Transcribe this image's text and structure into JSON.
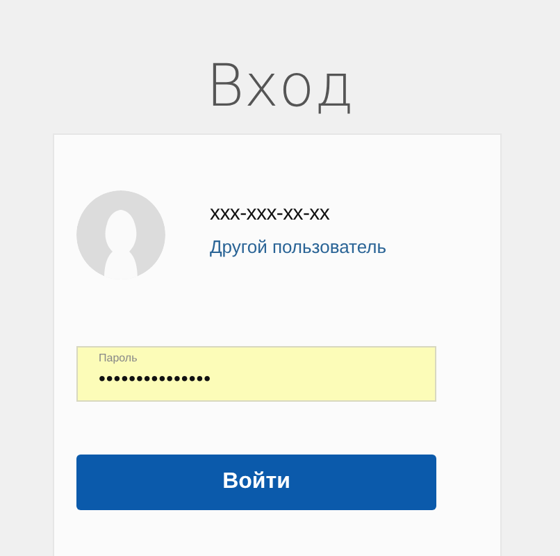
{
  "title": "Вход",
  "account": {
    "phone": "xxx-xxx-xx-xx",
    "switch_link": "Другой пользователь"
  },
  "password_field": {
    "label": "Пароль",
    "value": "•••••••••••••••",
    "autofilled": true
  },
  "submit_button": "Войти"
}
